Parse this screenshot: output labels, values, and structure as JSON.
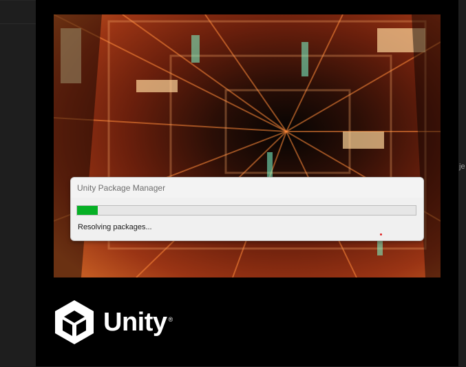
{
  "dialog": {
    "title": "Unity Package Manager",
    "progress": 0.06,
    "status": "Resolving packages..."
  },
  "brand": {
    "name": "Unity",
    "registered_mark": "®",
    "logo_icon": "unity-cube-logo"
  },
  "background": {
    "partial_text": "je"
  },
  "colors": {
    "progress_fill": "#06b025",
    "splash_bg": "#000000"
  }
}
